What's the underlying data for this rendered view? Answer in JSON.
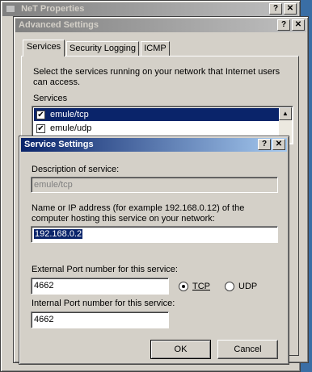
{
  "net_window": {
    "title": "NeT Properties",
    "help": "?",
    "close": "✕"
  },
  "advanced": {
    "title": "Advanced Settings",
    "help": "?",
    "close": "✕",
    "tabs": [
      "Services",
      "Security Logging",
      "ICMP"
    ],
    "instruction": "Select the services running on your network that Internet users can access.",
    "services_label": "Services",
    "services": [
      {
        "name": "emule/tcp",
        "checked": "✔"
      },
      {
        "name": "emule/udp",
        "checked": "✔"
      }
    ],
    "scroll_up": "▲"
  },
  "service": {
    "title": "Service Settings",
    "help": "?",
    "close": "✕",
    "description_label": "Description of service:",
    "description_value": "emule/tcp",
    "host_label_1": "Name or IP address (for example 192.168.0.12) of the",
    "host_label_2": "computer hosting this service on your network:",
    "host_value": "192.168.0.2",
    "ext_port_label": "External Port number for this service:",
    "ext_port_value": "4662",
    "tcp_label": "TCP",
    "udp_label": "UDP",
    "int_port_label": "Internal Port number for this service:",
    "int_port_value": "4662",
    "ok": "OK",
    "cancel": "Cancel"
  }
}
